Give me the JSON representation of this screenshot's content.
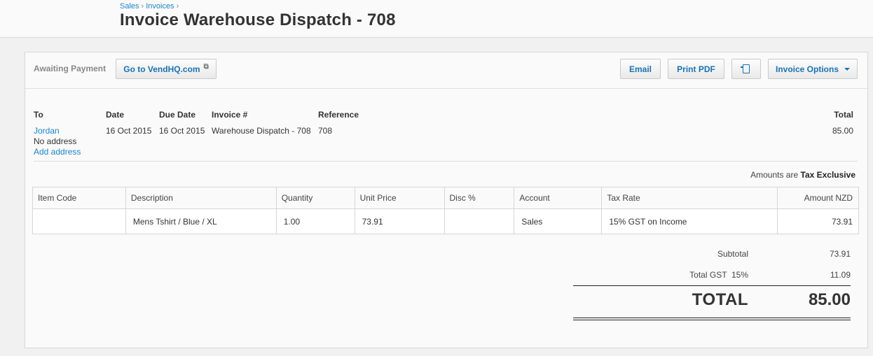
{
  "breadcrumb": {
    "items": [
      "Sales",
      "Invoices"
    ],
    "separator": "›"
  },
  "page_title": "Invoice Warehouse Dispatch - 708",
  "toolbar": {
    "status": "Awaiting Payment",
    "vend_label": "Go to VendHQ.com",
    "email_label": "Email",
    "pdf_label": "Print PDF",
    "options_label": "Invoice Options"
  },
  "info": {
    "to_label": "To",
    "date_label": "Date",
    "due_label": "Due Date",
    "invoice_label": "Invoice #",
    "ref_label": "Reference",
    "total_label": "Total",
    "to_name": "Jordan",
    "no_address": "No address",
    "add_address": "Add address",
    "date": "16 Oct 2015",
    "due_date": "16 Oct 2015",
    "invoice_no": "Warehouse Dispatch - 708",
    "reference": "708",
    "total": "85.00"
  },
  "amounts_note": {
    "prefix": "Amounts are",
    "value": "Tax Exclusive"
  },
  "table": {
    "headers": [
      "Item Code",
      "Description",
      "Quantity",
      "Unit Price",
      "Disc %",
      "Account",
      "Tax Rate",
      "Amount NZD"
    ],
    "row": {
      "item_code": "",
      "description": "Mens Tshirt / Blue / XL",
      "quantity": "1.00",
      "unit_price": "73.91",
      "disc": "",
      "account": "Sales",
      "tax_rate": "15% GST on Income",
      "amount": "73.91"
    }
  },
  "totals": {
    "subtotal_label": "Subtotal",
    "subtotal": "73.91",
    "gst_label": "Total GST  15%",
    "gst": "11.09",
    "total_label": "TOTAL",
    "total": "85.00"
  },
  "colors": {
    "link": "#1a85c8",
    "button_text": "#1a72b0"
  }
}
